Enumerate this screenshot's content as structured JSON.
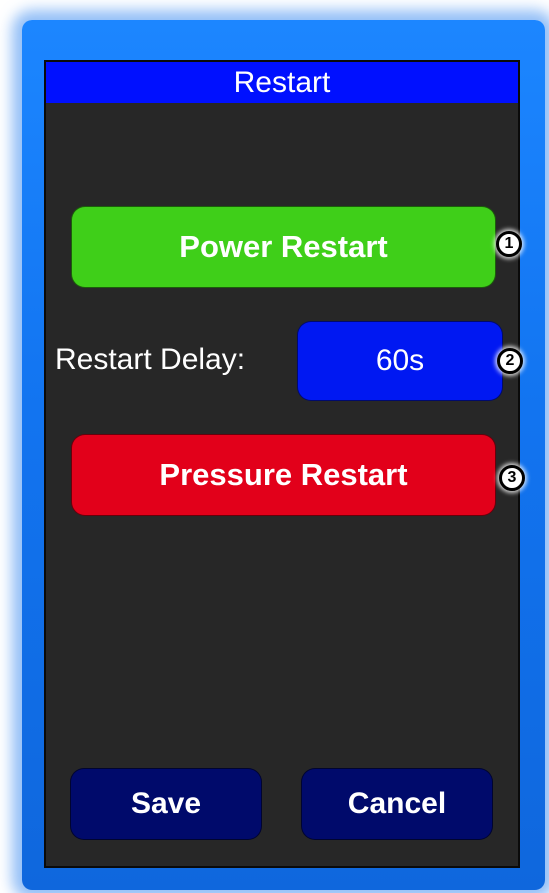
{
  "window": {
    "title": "Restart"
  },
  "buttons": {
    "power_restart": "Power Restart",
    "restart_delay_value": "60s",
    "pressure_restart": "Pressure Restart",
    "save": "Save",
    "cancel": "Cancel"
  },
  "labels": {
    "restart_delay": "Restart Delay:"
  },
  "callouts": [
    "1",
    "2",
    "3"
  ],
  "colors": {
    "title_bar": "#0010ff",
    "screen_bg": "#272727",
    "power_restart": "#3fcf19",
    "delay_value": "#0018f2",
    "pressure_restart": "#e2001a",
    "save_cancel": "#000a6b",
    "frame": "#1274f0"
  }
}
